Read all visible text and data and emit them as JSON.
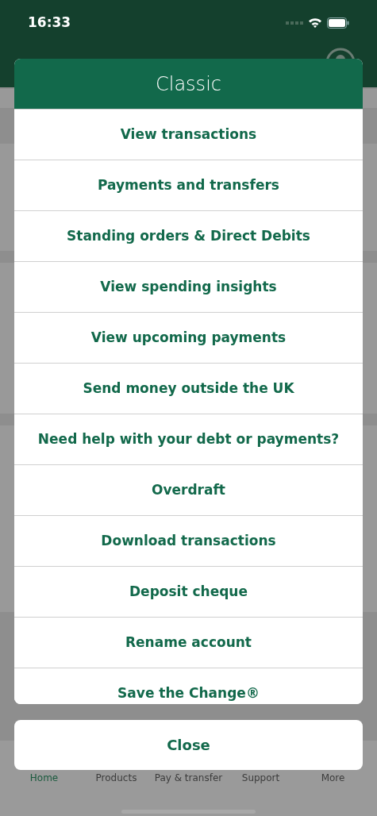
{
  "status_bar": {
    "time": "16:33"
  },
  "sheet": {
    "title": "Classic",
    "items": [
      {
        "label": "View transactions"
      },
      {
        "label": "Payments and transfers"
      },
      {
        "label": "Standing orders & Direct Debits"
      },
      {
        "label": "View spending insights"
      },
      {
        "label": "View upcoming payments"
      },
      {
        "label": "Send money outside the UK"
      },
      {
        "label": "Need help with your debt or payments?"
      },
      {
        "label": "Overdraft"
      },
      {
        "label": "Download transactions"
      },
      {
        "label": "Deposit cheque"
      },
      {
        "label": "Rename account"
      },
      {
        "label": "Save the Change®"
      }
    ],
    "close": "Close"
  },
  "tab_bar": [
    {
      "label": "Home",
      "selected": true
    },
    {
      "label": "Products",
      "selected": false
    },
    {
      "label": "Pay & transfer",
      "selected": false
    },
    {
      "label": "Support",
      "selected": false
    },
    {
      "label": "More",
      "selected": false
    }
  ]
}
